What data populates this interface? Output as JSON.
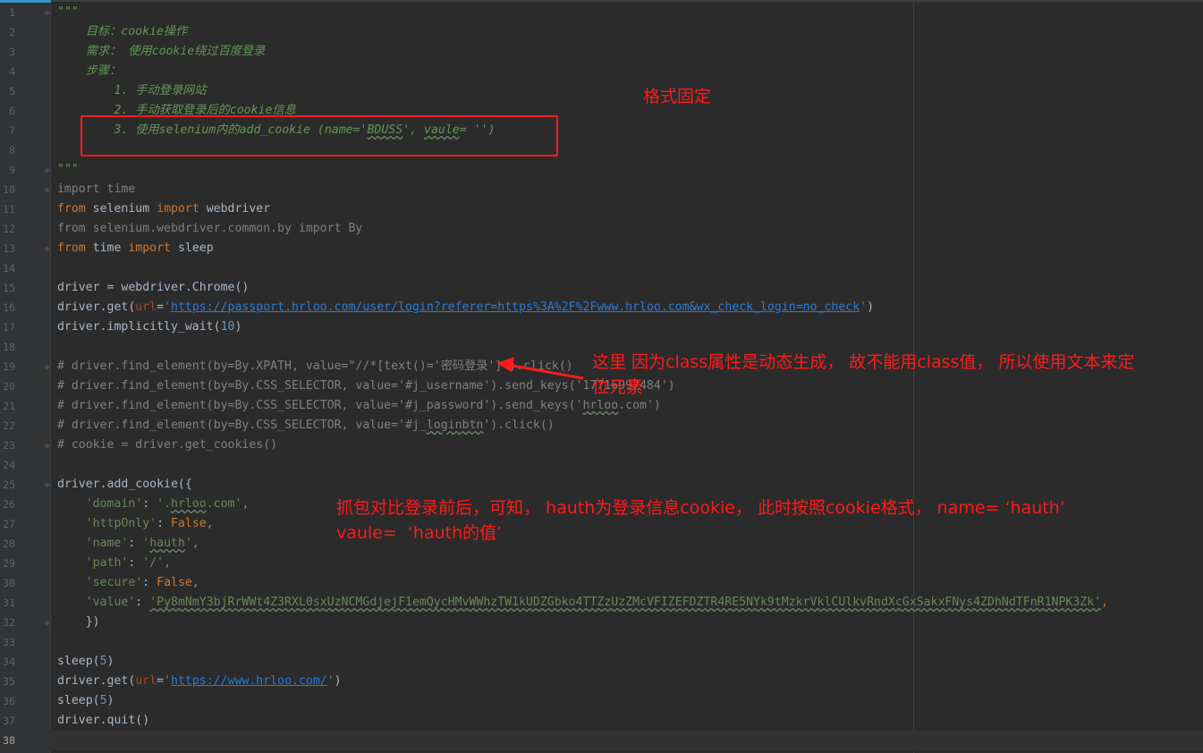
{
  "code_lines": [
    {
      "n": "1",
      "fold": true,
      "indent": "",
      "segs": [
        {
          "c": "t-doc",
          "t": "\"\"\""
        }
      ]
    },
    {
      "n": "2",
      "indent": "    ",
      "segs": [
        {
          "c": "t-doc",
          "t": "目标：cookie操作"
        }
      ]
    },
    {
      "n": "3",
      "indent": "    ",
      "segs": [
        {
          "c": "t-doc",
          "t": "需求： 使用cookie绕过百度登录"
        }
      ]
    },
    {
      "n": "4",
      "indent": "    ",
      "segs": [
        {
          "c": "t-doc",
          "t": "步骤："
        }
      ]
    },
    {
      "n": "5",
      "indent": "        ",
      "segs": [
        {
          "c": "t-doc",
          "t": "1. 手动登录网站"
        }
      ]
    },
    {
      "n": "6",
      "indent": "        ",
      "segs": [
        {
          "c": "t-doc",
          "t": "2. 手动获取登录后的cookie信息"
        }
      ]
    },
    {
      "n": "7",
      "indent": "        ",
      "segs": [
        {
          "c": "t-doc",
          "t": "3. 使用selenium内的add_cookie (name='"
        },
        {
          "c": "t-doc t-squig",
          "t": "BDUSS"
        },
        {
          "c": "t-doc",
          "t": "', "
        },
        {
          "c": "t-doc t-squig",
          "t": "vaule"
        },
        {
          "c": "t-doc",
          "t": "= '')"
        }
      ]
    },
    {
      "n": "8",
      "indent": "",
      "segs": []
    },
    {
      "n": "9",
      "fold": true,
      "indent": "",
      "segs": [
        {
          "c": "t-doc",
          "t": "\"\"\""
        }
      ]
    },
    {
      "n": "10",
      "fold": true,
      "indent": "",
      "segs": [
        {
          "c": "t-dim",
          "t": "import time"
        }
      ]
    },
    {
      "n": "11",
      "indent": "",
      "segs": [
        {
          "c": "t-kw",
          "t": "from"
        },
        {
          "c": "t-def",
          "t": " selenium "
        },
        {
          "c": "t-kw",
          "t": "import"
        },
        {
          "c": "t-def",
          "t": " webdriver"
        }
      ]
    },
    {
      "n": "12",
      "indent": "",
      "segs": [
        {
          "c": "t-dim",
          "t": "from selenium.webdriver.common.by import By"
        }
      ]
    },
    {
      "n": "13",
      "fold": true,
      "indent": "",
      "segs": [
        {
          "c": "t-kw",
          "t": "from"
        },
        {
          "c": "t-def",
          "t": " time "
        },
        {
          "c": "t-kw",
          "t": "import"
        },
        {
          "c": "t-def",
          "t": " sleep"
        }
      ]
    },
    {
      "n": "14",
      "indent": "",
      "segs": []
    },
    {
      "n": "15",
      "indent": "",
      "segs": [
        {
          "c": "t-def",
          "t": "driver = webdriver.Chrome()"
        }
      ]
    },
    {
      "n": "16",
      "indent": "",
      "segs": [
        {
          "c": "t-def",
          "t": "driver.get("
        },
        {
          "c": "t-param",
          "t": "url"
        },
        {
          "c": "t-def",
          "t": "="
        },
        {
          "c": "t-str",
          "t": "'"
        },
        {
          "c": "t-url",
          "t": "https://passport.hrloo.com/user/login?referer=https%3A%2F%2Fwww.hrloo.com&wx_check_login=no_check"
        },
        {
          "c": "t-str",
          "t": "'"
        },
        {
          "c": "t-def",
          "t": ")"
        }
      ]
    },
    {
      "n": "17",
      "indent": "",
      "segs": [
        {
          "c": "t-def",
          "t": "driver.implicitly_wait("
        },
        {
          "c": "t-num",
          "t": "10"
        },
        {
          "c": "t-def",
          "t": ")"
        }
      ]
    },
    {
      "n": "18",
      "indent": "",
      "segs": []
    },
    {
      "n": "19",
      "fold": true,
      "indent": "",
      "segs": [
        {
          "c": "t-com",
          "t": "# driver.find_element(by=By.XPATH, value=\"//*[text()='密码登录']\").click()"
        }
      ]
    },
    {
      "n": "20",
      "indent": "",
      "segs": [
        {
          "c": "t-com",
          "t": "# driver.find_element(by=By.CSS_SELECTOR, value='#j_username').send_keys('17716997484')"
        }
      ]
    },
    {
      "n": "21",
      "indent": "",
      "segs": [
        {
          "c": "t-com",
          "t": "# driver.find_element(by=By.CSS_SELECTOR, value='#j_password').send_keys('"
        },
        {
          "c": "t-com t-squig",
          "t": "hrloo"
        },
        {
          "c": "t-com",
          "t": ".com')"
        }
      ]
    },
    {
      "n": "22",
      "indent": "",
      "segs": [
        {
          "c": "t-com",
          "t": "# driver.find_element(by=By.CSS_SELECTOR, value='#j_"
        },
        {
          "c": "t-com t-squig",
          "t": "loginbtn"
        },
        {
          "c": "t-com",
          "t": "').click()"
        }
      ]
    },
    {
      "n": "23",
      "fold": true,
      "indent": "",
      "segs": [
        {
          "c": "t-com",
          "t": "# cookie = driver.get_cookies()"
        }
      ]
    },
    {
      "n": "24",
      "indent": "",
      "segs": []
    },
    {
      "n": "25",
      "fold": true,
      "indent": "",
      "segs": [
        {
          "c": "t-def",
          "t": "driver.add_cookie({"
        }
      ]
    },
    {
      "n": "26",
      "indent": "    ",
      "segs": [
        {
          "c": "t-str",
          "t": "'domain'"
        },
        {
          "c": "t-def",
          "t": ": "
        },
        {
          "c": "t-str",
          "t": "'."
        },
        {
          "c": "t-str t-squig",
          "t": "hrloo"
        },
        {
          "c": "t-str",
          "t": ".com'"
        },
        {
          "c": "t-kw",
          "t": ","
        }
      ]
    },
    {
      "n": "27",
      "indent": "    ",
      "segs": [
        {
          "c": "t-str",
          "t": "'httpOnly'"
        },
        {
          "c": "t-def",
          "t": ": "
        },
        {
          "c": "t-kw",
          "t": "False,"
        }
      ]
    },
    {
      "n": "28",
      "indent": "    ",
      "segs": [
        {
          "c": "t-str",
          "t": "'name'"
        },
        {
          "c": "t-def",
          "t": ": "
        },
        {
          "c": "t-str",
          "t": "'"
        },
        {
          "c": "t-str t-squig",
          "t": "hauth"
        },
        {
          "c": "t-str",
          "t": "'"
        },
        {
          "c": "t-kw",
          "t": ","
        }
      ]
    },
    {
      "n": "29",
      "indent": "    ",
      "segs": [
        {
          "c": "t-str",
          "t": "'path'"
        },
        {
          "c": "t-def",
          "t": ": "
        },
        {
          "c": "t-str",
          "t": "'/'"
        },
        {
          "c": "t-kw",
          "t": ","
        }
      ]
    },
    {
      "n": "30",
      "indent": "    ",
      "segs": [
        {
          "c": "t-str",
          "t": "'secure'"
        },
        {
          "c": "t-def",
          "t": ": "
        },
        {
          "c": "t-kw",
          "t": "False,"
        }
      ]
    },
    {
      "n": "31",
      "indent": "    ",
      "segs": [
        {
          "c": "t-str",
          "t": "'value'"
        },
        {
          "c": "t-def",
          "t": ": "
        },
        {
          "c": "t-str t-squig",
          "t": "'Py8mNmY3bjRrWWt4Z3RXL0sxUzNCMGdjejF1emQycHMvWWhzTW1kUDZGbko4TTZzUzZMcVFIZEFDZTR4RE5NYk9tMzkrVklCUlkvRndXcGxSakxFNys4ZDhNdTFnR1NPK3Zk'"
        },
        {
          "c": "t-kw",
          "t": ","
        }
      ]
    },
    {
      "n": "32",
      "fold": true,
      "indent": "    ",
      "segs": [
        {
          "c": "t-def",
          "t": "})"
        }
      ]
    },
    {
      "n": "33",
      "indent": "",
      "segs": []
    },
    {
      "n": "34",
      "indent": "",
      "segs": [
        {
          "c": "t-def",
          "t": "sleep("
        },
        {
          "c": "t-num",
          "t": "5"
        },
        {
          "c": "t-def",
          "t": ")"
        }
      ]
    },
    {
      "n": "35",
      "indent": "",
      "segs": [
        {
          "c": "t-def",
          "t": "driver.get("
        },
        {
          "c": "t-param",
          "t": "url"
        },
        {
          "c": "t-def",
          "t": "="
        },
        {
          "c": "t-str",
          "t": "'"
        },
        {
          "c": "t-url",
          "t": "https://www.hrloo.com/"
        },
        {
          "c": "t-str",
          "t": "'"
        },
        {
          "c": "t-def",
          "t": ")"
        }
      ]
    },
    {
      "n": "36",
      "indent": "",
      "segs": [
        {
          "c": "t-def",
          "t": "sleep("
        },
        {
          "c": "t-num",
          "t": "5"
        },
        {
          "c": "t-def",
          "t": ")"
        }
      ]
    },
    {
      "n": "37",
      "indent": "",
      "segs": [
        {
          "c": "t-def",
          "t": "driver.quit()"
        }
      ]
    },
    {
      "n": "38",
      "current": true,
      "indent": "",
      "segs": []
    }
  ],
  "annotations": {
    "format_fixed": "格式固定",
    "xpath_note_line1": "这里 因为class属性是动态生成， 故不能用class值， 所以使用文本来定",
    "xpath_note_line2": "位元素",
    "capture_note_line1": "抓包对比登录前后，可知， hauth为登录信息cookie， 此时按照cookie格式， name= ‘hauth’",
    "capture_note_line2": "vaule=  ‘hauth的值’"
  },
  "colors": {
    "background": "#2b2b2b",
    "annotation_red": "#ff1b1b",
    "keyword": "#cc7832",
    "string": "#6a8759",
    "docstring": "#629755",
    "comment": "#808080",
    "url": "#287bde"
  }
}
